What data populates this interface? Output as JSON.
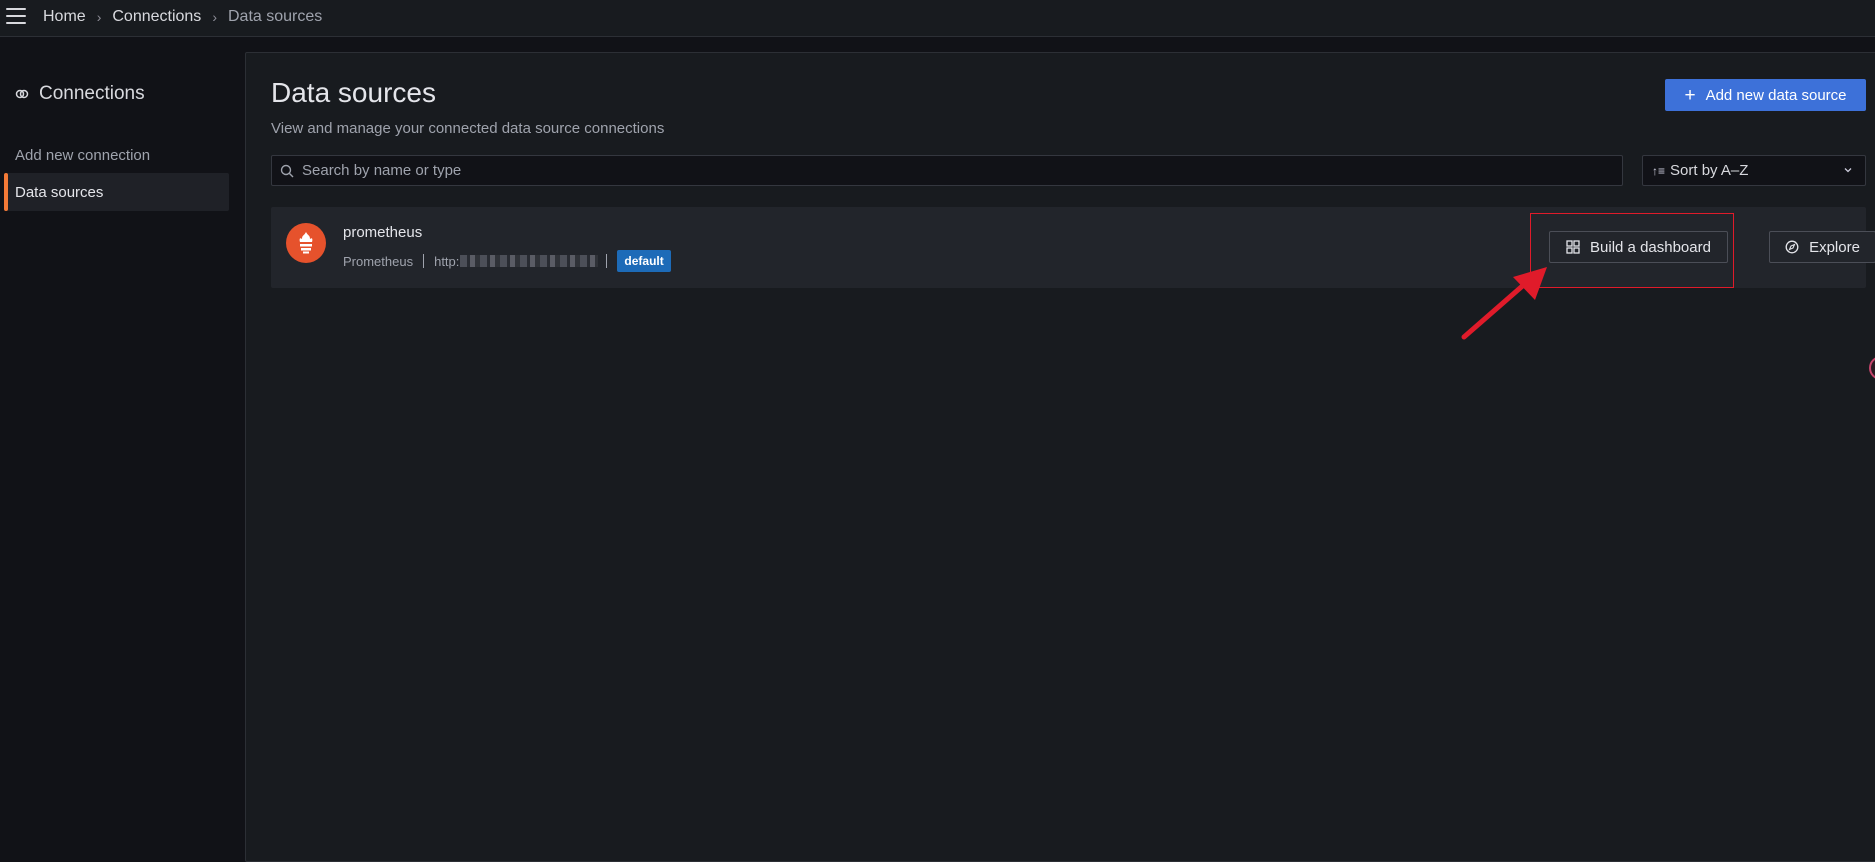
{
  "topbar": {
    "breadcrumbs": [
      "Home",
      "Connections",
      "Data sources"
    ]
  },
  "sidebar": {
    "title": "Connections",
    "items": [
      {
        "label": "Add new connection",
        "active": false
      },
      {
        "label": "Data sources",
        "active": true
      }
    ]
  },
  "main": {
    "title": "Data sources",
    "subtitle": "View and manage your connected data source connections",
    "add_button_label": "Add new data source",
    "search_placeholder": "Search by name or type",
    "sort_label": "Sort by A–Z",
    "datasources": [
      {
        "name": "prometheus",
        "type": "Prometheus",
        "url_prefix": "http:",
        "badge": "default",
        "build_label": "Build a dashboard",
        "explore_label": "Explore"
      }
    ]
  },
  "colors": {
    "accent": "#f47a37",
    "primary_button": "#3d71d9",
    "annotation": "#e01b2a",
    "prometheus_logo": "#e6522c"
  },
  "icons": [
    "hamburger-icon",
    "connections-icon",
    "plus-icon",
    "search-icon",
    "sort-icon",
    "chevron-down-icon",
    "prometheus-logo-icon",
    "dashboard-grid-icon",
    "compass-icon"
  ]
}
